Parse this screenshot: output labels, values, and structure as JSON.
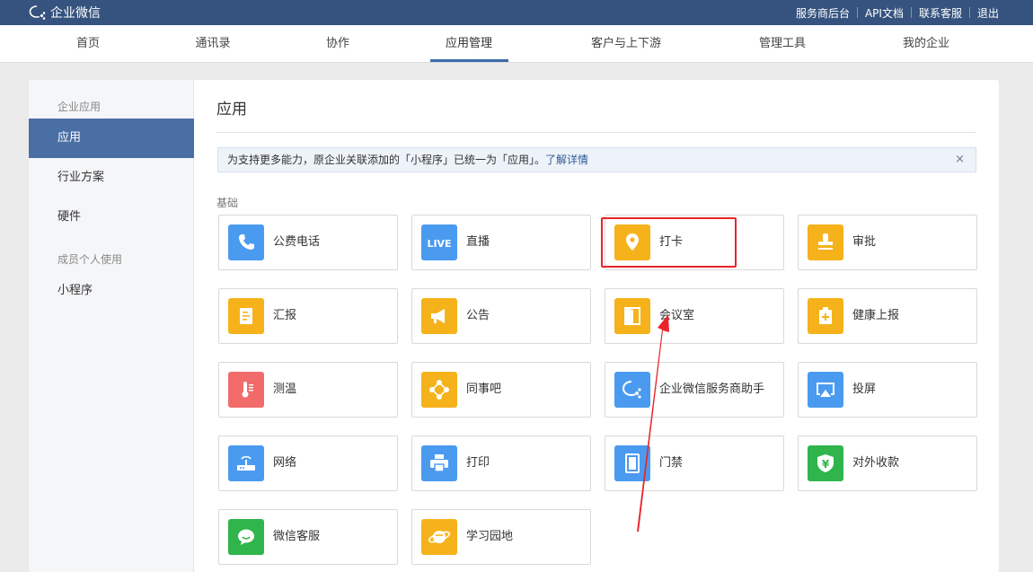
{
  "topbar": {
    "logo_text": "企业微信",
    "links": [
      "服务商后台",
      "API文档",
      "联系客服",
      "退出"
    ]
  },
  "nav": {
    "tabs": [
      "首页",
      "通讯录",
      "协作",
      "应用管理",
      "客户与上下游",
      "管理工具",
      "我的企业"
    ],
    "active": "应用管理"
  },
  "sidebar": {
    "group1": "企业应用",
    "items1": [
      "应用",
      "行业方案",
      "硬件"
    ],
    "active": "应用",
    "group2": "成员个人使用",
    "items2": [
      "小程序"
    ]
  },
  "main": {
    "title": "应用",
    "notice_text": "为支持更多能力，原企业关联添加的「小程序」已统一为「应用」。",
    "notice_link": "了解详情",
    "notice_close": "×",
    "section_label": "基础",
    "apps": [
      {
        "name": "公费电话",
        "icon": "phone-icon",
        "color": "#4a9af0"
      },
      {
        "name": "直播",
        "icon": "live-icon",
        "color": "#4a9af0"
      },
      {
        "name": "打卡",
        "icon": "location-pin-icon",
        "color": "#f5b21b"
      },
      {
        "name": "审批",
        "icon": "stamp-icon",
        "color": "#f5b21b"
      },
      {
        "name": "汇报",
        "icon": "report-icon",
        "color": "#f5b21b"
      },
      {
        "name": "公告",
        "icon": "megaphone-icon",
        "color": "#f5b21b"
      },
      {
        "name": "会议室",
        "icon": "door-icon",
        "color": "#f5b21b"
      },
      {
        "name": "健康上报",
        "icon": "health-icon",
        "color": "#f5b21b"
      },
      {
        "name": "测温",
        "icon": "thermometer-icon",
        "color": "#f26b6b"
      },
      {
        "name": "同事吧",
        "icon": "network-icon",
        "color": "#f5b21b"
      },
      {
        "name": "企业微信服务商助手",
        "icon": "chat-bubble-icon",
        "color": "#4a9af0"
      },
      {
        "name": "投屏",
        "icon": "screen-cast-icon",
        "color": "#4a9af0"
      },
      {
        "name": "网络",
        "icon": "router-icon",
        "color": "#4a9af0"
      },
      {
        "name": "打印",
        "icon": "printer-icon",
        "color": "#4a9af0"
      },
      {
        "name": "门禁",
        "icon": "access-door-icon",
        "color": "#4a9af0"
      },
      {
        "name": "对外收款",
        "icon": "yuan-shield-icon",
        "color": "#2fb54b"
      },
      {
        "name": "微信客服",
        "icon": "wechat-service-icon",
        "color": "#2fb54b"
      },
      {
        "name": "学习园地",
        "icon": "planet-icon",
        "color": "#f5b21b"
      }
    ]
  },
  "annotation": {
    "highlight_color": "#e8242a"
  }
}
